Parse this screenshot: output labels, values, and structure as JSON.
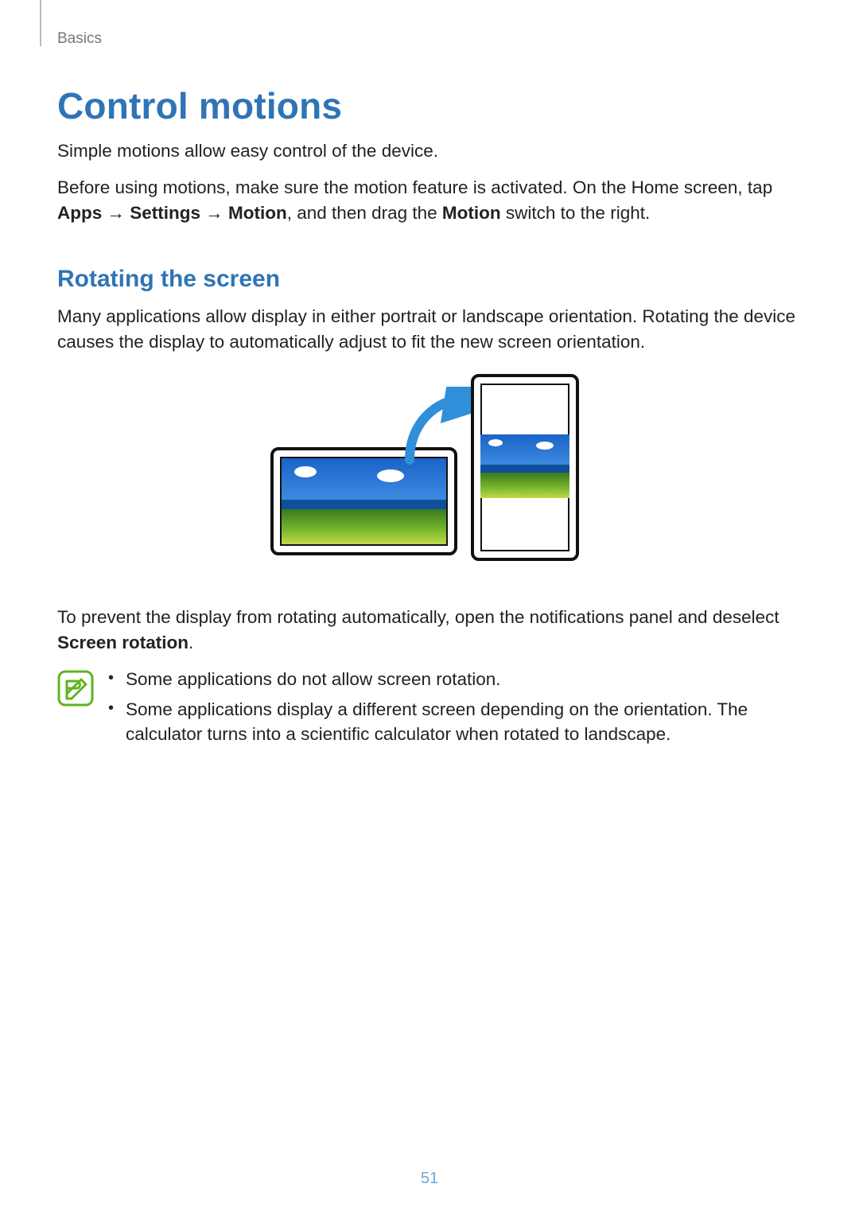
{
  "breadcrumb": "Basics",
  "title": "Control motions",
  "intro": "Simple motions allow easy control of the device.",
  "before_1": "Before using motions, make sure the motion feature is activated. On the Home screen, tap ",
  "apps": "Apps",
  "settings": "Settings",
  "motion": "Motion",
  "before_2": ", and then drag the ",
  "motion2": "Motion",
  "before_3": " switch to the right.",
  "arrow": " → ",
  "subheading": "Rotating the screen",
  "rotate_body": "Many applications allow display in either portrait or landscape orientation. Rotating the device causes the display to automatically adjust to fit the new screen orientation.",
  "prevent_1": "To prevent the display from rotating automatically, open the notifications panel and deselect ",
  "screen_rotation": "Screen rotation",
  "prevent_2": ".",
  "note1": "Some applications do not allow screen rotation.",
  "note2": "Some applications display a different screen depending on the orientation. The calculator turns into a scientific calculator when rotated to landscape.",
  "page_number": "51"
}
